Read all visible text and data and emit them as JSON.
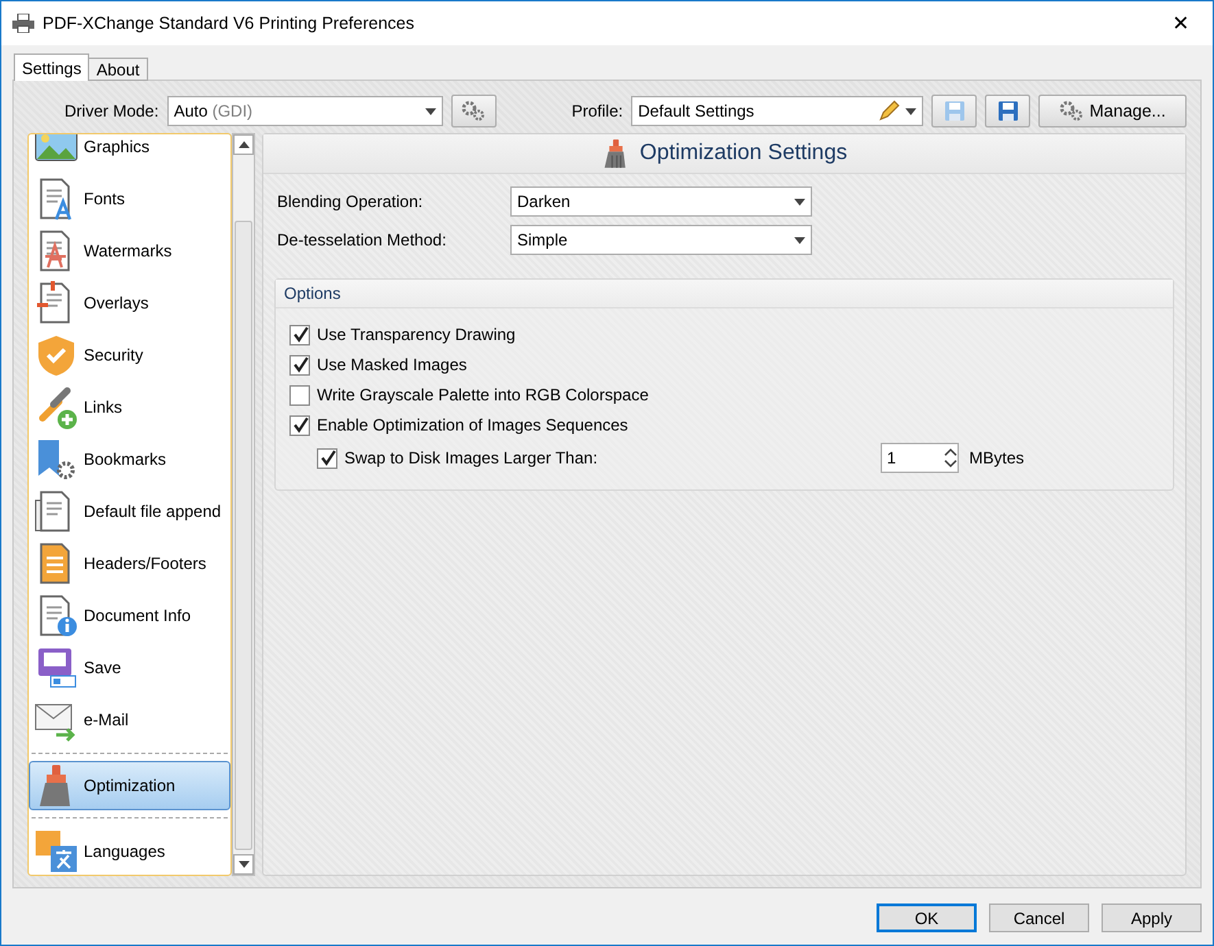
{
  "window": {
    "title": "PDF-XChange Standard V6 Printing Preferences",
    "close": "✕"
  },
  "tabs": [
    {
      "label": "Settings",
      "selected": true
    },
    {
      "label": "About",
      "selected": false
    }
  ],
  "toolbar": {
    "driver_mode_label": "Driver Mode:",
    "driver_mode_value": "Auto",
    "driver_mode_note": "(GDI)",
    "profile_label": "Profile:",
    "profile_value": "Default Settings",
    "manage_button": "Manage..."
  },
  "sidebar": {
    "items": [
      {
        "kind": "item",
        "label": "Graphics",
        "selected": false
      },
      {
        "kind": "item",
        "label": "Fonts",
        "selected": false
      },
      {
        "kind": "item",
        "label": "Watermarks",
        "selected": false
      },
      {
        "kind": "item",
        "label": "Overlays",
        "selected": false
      },
      {
        "kind": "item",
        "label": "Security",
        "selected": false
      },
      {
        "kind": "item",
        "label": "Links",
        "selected": false
      },
      {
        "kind": "item",
        "label": "Bookmarks",
        "selected": false
      },
      {
        "kind": "item",
        "label": "Default file append",
        "selected": false
      },
      {
        "kind": "item",
        "label": "Headers/Footers",
        "selected": false
      },
      {
        "kind": "item",
        "label": "Document Info",
        "selected": false
      },
      {
        "kind": "item",
        "label": "Save",
        "selected": false
      },
      {
        "kind": "item",
        "label": "e-Mail",
        "selected": false
      },
      {
        "kind": "separator"
      },
      {
        "kind": "item",
        "label": "Optimization",
        "selected": true
      },
      {
        "kind": "separator"
      },
      {
        "kind": "item",
        "label": "Languages",
        "selected": false
      }
    ]
  },
  "panel": {
    "title": "Optimization Settings",
    "fields": [
      {
        "label": "Blending Operation:",
        "value": "Darken"
      },
      {
        "label": "De-tesselation Method:",
        "value": "Simple"
      }
    ],
    "options": {
      "title": "Options",
      "rows": [
        {
          "kind": "checkbox",
          "label": "Use Transparency Drawing",
          "checked": true
        },
        {
          "kind": "checkbox",
          "label": "Use Masked Images",
          "checked": true
        },
        {
          "kind": "checkbox",
          "label": "Write Grayscale Palette into RGB Colorspace",
          "checked": false
        },
        {
          "kind": "checkbox",
          "label": "Enable Optimization of Images Sequences",
          "checked": true
        },
        {
          "kind": "spin",
          "label": "Swap to Disk Images Larger Than:",
          "checked": true,
          "value": "1",
          "unit": "MBytes"
        }
      ]
    }
  },
  "buttons": [
    {
      "label": "OK",
      "default": true
    },
    {
      "label": "Cancel",
      "default": false
    },
    {
      "label": "Apply",
      "default": false
    }
  ]
}
